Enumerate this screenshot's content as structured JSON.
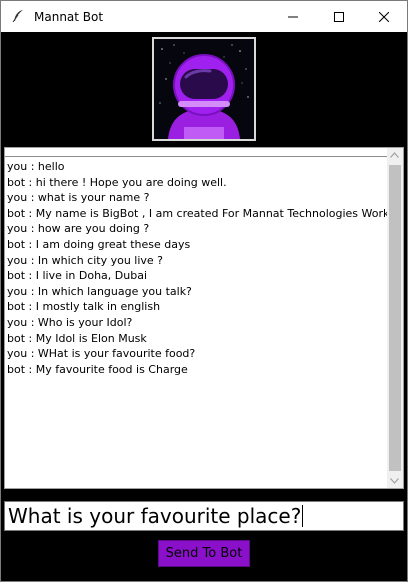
{
  "window": {
    "title": "Mannat Bot"
  },
  "titlebar": {
    "icons": [
      "feather-icon",
      "minimize-icon",
      "maximize-icon",
      "close-icon"
    ]
  },
  "avatar": {
    "description_icon": "astronaut-icon"
  },
  "chat": {
    "lines": [
      "you : hello",
      "bot : hi there ! Hope you are doing well.",
      "you : what is your name ?",
      "bot : My name is BigBot , I am created For Mannat Technologies Work D",
      "you : how are you doing ?",
      "bot : I am doing great these days",
      "you : In which city you live ?",
      "bot : I live in Doha, Dubai",
      "you : In which language you talk?",
      "bot : I mostly talk in english",
      "you : Who is your Idol?",
      "bot : My Idol is Elon Musk",
      "you : WHat is your favourite food?",
      "bot : My favourite food is Charge"
    ]
  },
  "input": {
    "value": "What is your favourite place?"
  },
  "send_button": {
    "label": "Send To Bot"
  },
  "colors": {
    "background": "#000000",
    "button": "#8a10c9",
    "astronaut": "#a020f0"
  }
}
